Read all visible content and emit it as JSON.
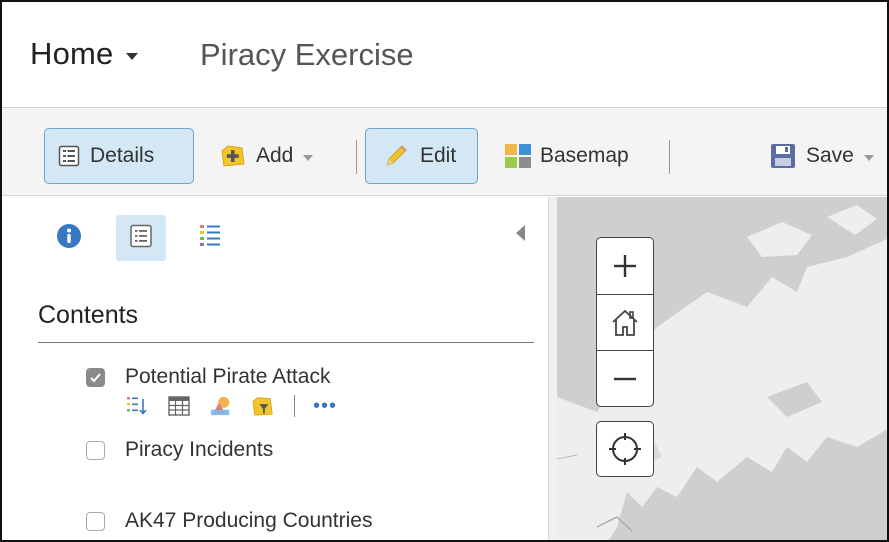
{
  "header": {
    "home_label": "Home",
    "map_title": "Piracy Exercise"
  },
  "toolbar": {
    "details_label": "Details",
    "add_label": "Add",
    "edit_label": "Edit",
    "basemap_label": "Basemap",
    "save_label": "Save"
  },
  "panel": {
    "tabs": [
      "about-icon",
      "content-icon",
      "legend-icon"
    ],
    "contents_title": "Contents",
    "layers": [
      {
        "label": "Potential Pirate Attack",
        "checked": true
      },
      {
        "label": "Piracy Incidents",
        "checked": false
      },
      {
        "label": "AK47 Producing Countries",
        "checked": false
      }
    ],
    "layer_tools": [
      "show-table-of-contents-icon",
      "show-table-icon",
      "change-style-icon",
      "filter-icon",
      "more-options-icon"
    ],
    "more_label": "•••"
  },
  "map": {
    "controls": [
      "zoom-in",
      "default-extent",
      "zoom-out",
      "locate"
    ]
  },
  "colors": {
    "accent_blue": "#3878c4",
    "active_bg": "#d4e7f5",
    "map_land": "#eeeeee",
    "map_water": "#cfcfcf"
  }
}
